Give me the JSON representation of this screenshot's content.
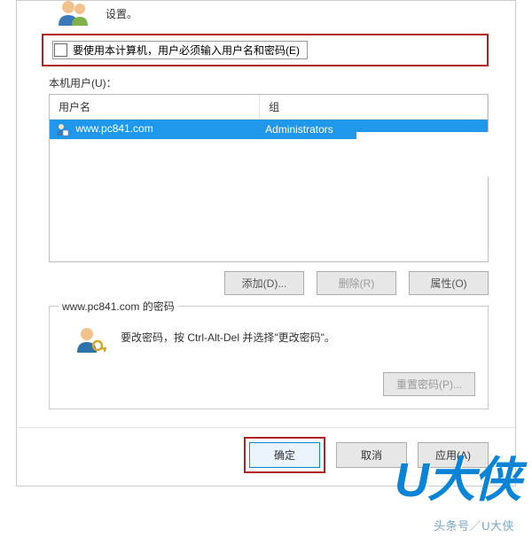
{
  "top_desc_line": "设置。",
  "checkbox": {
    "label": "要使用本计算机，用户必须输入用户名和密码(E)"
  },
  "section_label": "本机用户(U)：",
  "list": {
    "col_user": "用户名",
    "col_group": "组",
    "rows": [
      {
        "user": "www.pc841.com",
        "group": "Administrators"
      }
    ]
  },
  "buttons": {
    "add": "添加(D)...",
    "remove": "删除(R)",
    "properties": "属性(O)"
  },
  "fieldset": {
    "legend": "www.pc841.com 的密码",
    "text": "要改密码，按 Ctrl-Alt-Del 并选择\"更改密码\"。",
    "reset": "重置密码(P)..."
  },
  "footer": {
    "ok": "确定",
    "cancel": "取消",
    "apply": "应用(A)"
  },
  "watermark": "U大侠",
  "caption": "头条号／U大侠"
}
